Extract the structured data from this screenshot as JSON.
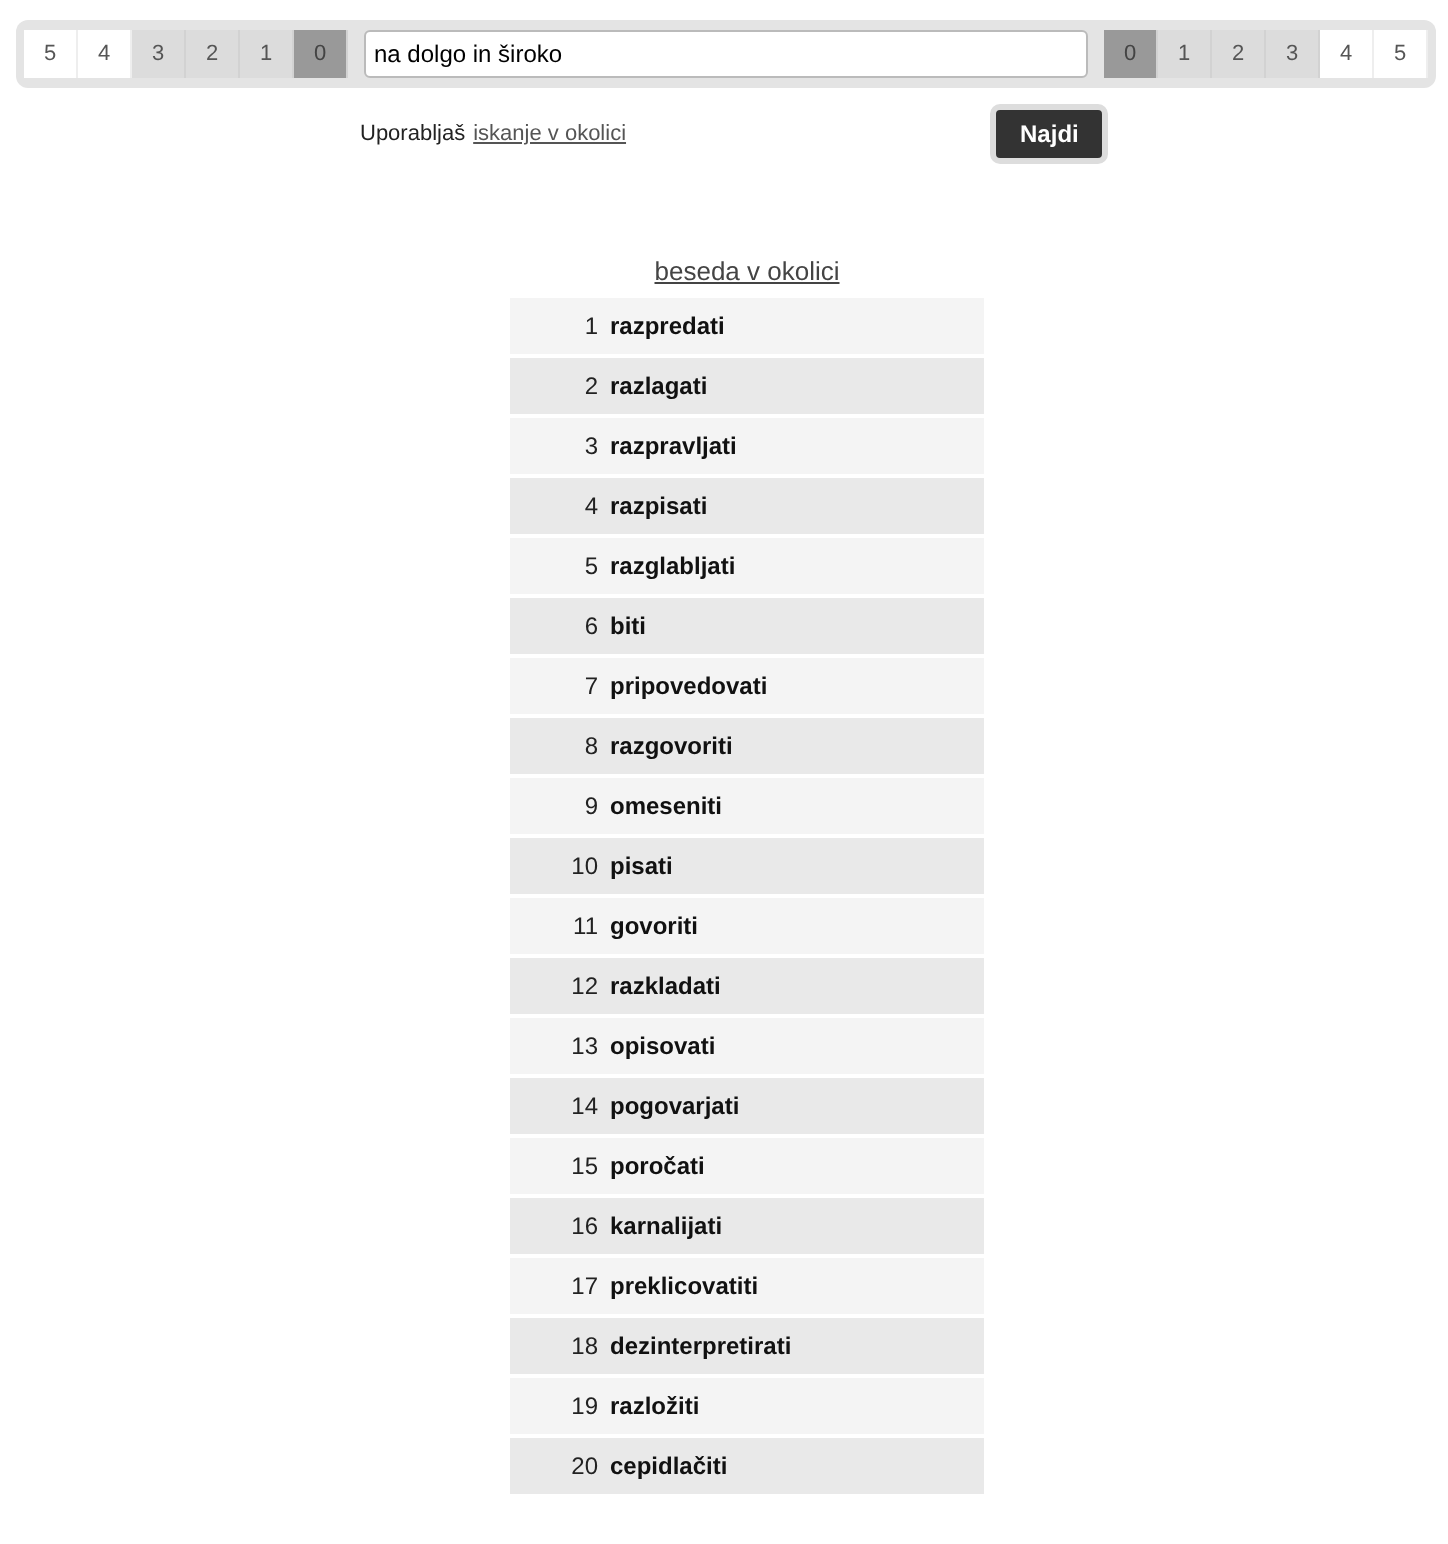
{
  "left_distances": [
    {
      "label": "5",
      "selected": false,
      "in_range": false
    },
    {
      "label": "4",
      "selected": false,
      "in_range": false
    },
    {
      "label": "3",
      "selected": false,
      "in_range": true
    },
    {
      "label": "2",
      "selected": false,
      "in_range": true
    },
    {
      "label": "1",
      "selected": false,
      "in_range": true
    },
    {
      "label": "0",
      "selected": true,
      "in_range": true
    }
  ],
  "search": {
    "value": "na dolgo in široko"
  },
  "right_distances": [
    {
      "label": "0",
      "selected": true,
      "in_range": true
    },
    {
      "label": "1",
      "selected": false,
      "in_range": true
    },
    {
      "label": "2",
      "selected": false,
      "in_range": true
    },
    {
      "label": "3",
      "selected": false,
      "in_range": true
    },
    {
      "label": "4",
      "selected": false,
      "in_range": false
    },
    {
      "label": "5",
      "selected": false,
      "in_range": false
    }
  ],
  "mode": {
    "text": "Uporabljaš",
    "link": "iskanje v okolici"
  },
  "button": "Najdi",
  "results": {
    "header": "beseda v okolici",
    "rows": [
      {
        "rank": "1",
        "word": "razpredati"
      },
      {
        "rank": "2",
        "word": "razlagati"
      },
      {
        "rank": "3",
        "word": "razpravljati"
      },
      {
        "rank": "4",
        "word": "razpisati"
      },
      {
        "rank": "5",
        "word": "razglabljati"
      },
      {
        "rank": "6",
        "word": "biti"
      },
      {
        "rank": "7",
        "word": "pripovedovati"
      },
      {
        "rank": "8",
        "word": "razgovoriti"
      },
      {
        "rank": "9",
        "word": "omeseniti"
      },
      {
        "rank": "10",
        "word": "pisati"
      },
      {
        "rank": "11",
        "word": "govoriti"
      },
      {
        "rank": "12",
        "word": "razkladati"
      },
      {
        "rank": "13",
        "word": "opisovati"
      },
      {
        "rank": "14",
        "word": "pogovarjati"
      },
      {
        "rank": "15",
        "word": "poročati"
      },
      {
        "rank": "16",
        "word": "karnalijati"
      },
      {
        "rank": "17",
        "word": "preklicovatiti"
      },
      {
        "rank": "18",
        "word": "dezinterpretirati"
      },
      {
        "rank": "19",
        "word": "razložiti"
      },
      {
        "rank": "20",
        "word": "cepidlačiti"
      }
    ]
  }
}
